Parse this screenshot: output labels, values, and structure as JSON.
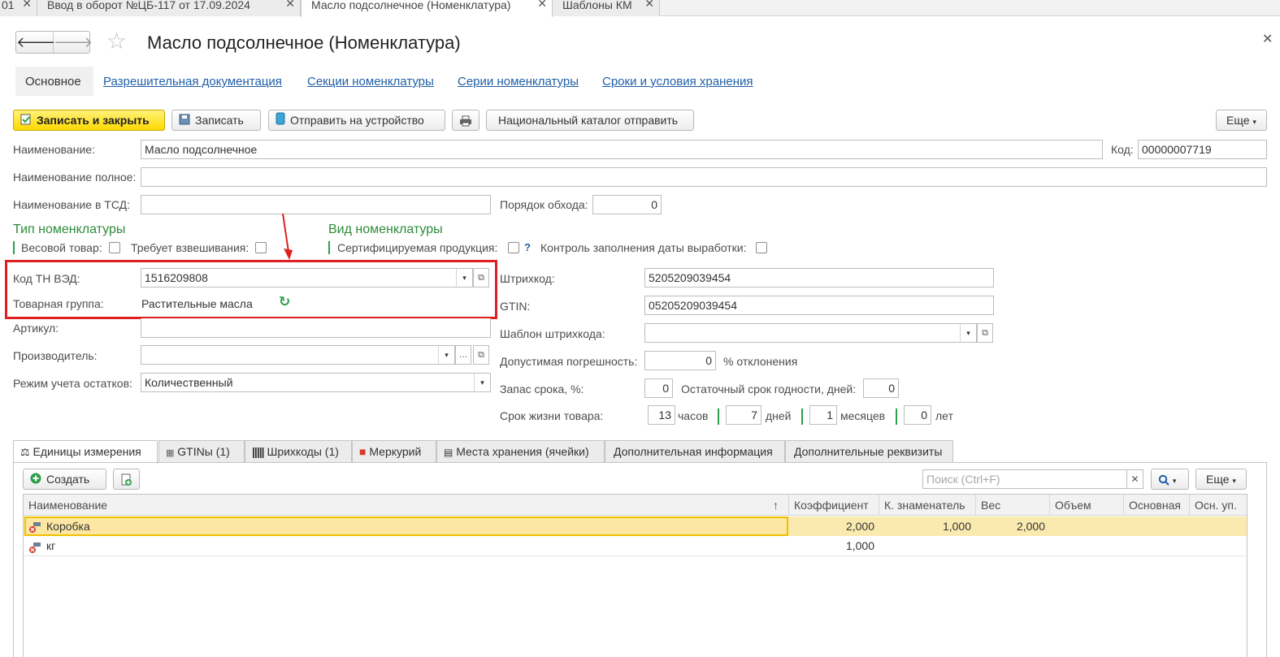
{
  "window_tabs": [
    {
      "label": "01"
    },
    {
      "label": "Ввод в оборот №ЦБ-117 от 17.09.2024"
    },
    {
      "label": "Масло подсолнечное (Номенклатура)"
    },
    {
      "label": "Шаблоны КМ"
    }
  ],
  "header": {
    "title": "Масло подсолнечное (Номенклатура)"
  },
  "nav": {
    "current": "Основное",
    "links": [
      "Разрешительная документация",
      "Секции номенклатуры",
      "Серии номенклатуры",
      "Сроки и условия хранения"
    ]
  },
  "toolbar": {
    "save_close": "Записать и закрыть",
    "save": "Записать",
    "send_device": "Отправить на устройство",
    "national_catalog": "Национальный каталог отправить",
    "more": "Еще"
  },
  "form": {
    "name_label": "Наименование:",
    "name_value": "Масло подсолнечное",
    "code_label": "Код:",
    "code_value": "00000007719",
    "full_name_label": "Наименование полное:",
    "full_name_value": "",
    "tsd_name_label": "Наименование в ТСД:",
    "tsd_name_value": "",
    "order_label": "Порядок обхода:",
    "order_value": "0",
    "type_heading": "Тип номенклатуры",
    "weight_label": "Весовой товар:",
    "need_weigh_label": "Требует взвешивания:",
    "kind_heading": "Вид номенклатуры",
    "certified_label": "Сертифицируемая продукция:",
    "help_mark": "?",
    "prod_date_label": "Контроль заполнения даты выработки:",
    "tnved_label": "Код ТН ВЭД:",
    "tnved_value": "1516209808",
    "group_label": "Товарная группа:",
    "group_value": "Растительные масла",
    "article_label": "Артикул:",
    "article_value": "",
    "maker_label": "Производитель:",
    "maker_value": "",
    "stock_mode_label": "Режим учета остатков:",
    "stock_mode_value": "Количественный",
    "barcode_label": "Штрихкод:",
    "barcode_value": "5205209039454",
    "gtin_label": "GTIN:",
    "gtin_value": "05205209039454",
    "barcode_tpl_label": "Шаблон штрихкода:",
    "barcode_tpl_value": "",
    "tolerance_label": "Допустимая погрешность:",
    "tolerance_value": "0",
    "tolerance_unit": "% отклонения",
    "reserve_label": "Запас срока, %:",
    "reserve_value": "0",
    "remaining_label": "Остаточный срок годности, дней:",
    "remaining_value": "0",
    "life_label": "Срок жизни товара:",
    "life_hours": "13",
    "hours_unit": "часов",
    "life_days": "7",
    "days_unit": "дней",
    "life_months": "1",
    "months_unit": "месяцев",
    "life_years": "0",
    "years_unit": "лет"
  },
  "bottom_tabs": [
    {
      "label": "Единицы измерения"
    },
    {
      "label": "GTINы (1)"
    },
    {
      "label": "Шрихкоды (1)"
    },
    {
      "label": "Меркурий"
    },
    {
      "label": "Места хранения (ячейки)"
    },
    {
      "label": "Дополнительная информация"
    },
    {
      "label": "Дополнительные реквизиты"
    }
  ],
  "table_toolbar": {
    "create": "Создать",
    "search_placeholder": "Поиск (Ctrl+F)",
    "more": "Еще"
  },
  "table": {
    "columns": [
      "Наименование",
      "Коэффициент",
      "К. знаменатель",
      "Вес",
      "Объем",
      "Основная",
      "Осн. уп."
    ],
    "sort_mark": "↑",
    "rows": [
      {
        "name": "Коробка",
        "coef": "2,000",
        "denom": "1,000",
        "weight": "2,000",
        "volume": "",
        "main": "",
        "main_pack": ""
      },
      {
        "name": "кг",
        "coef": "1,000",
        "denom": "",
        "weight": "",
        "volume": "",
        "main": "",
        "main_pack": ""
      }
    ]
  }
}
